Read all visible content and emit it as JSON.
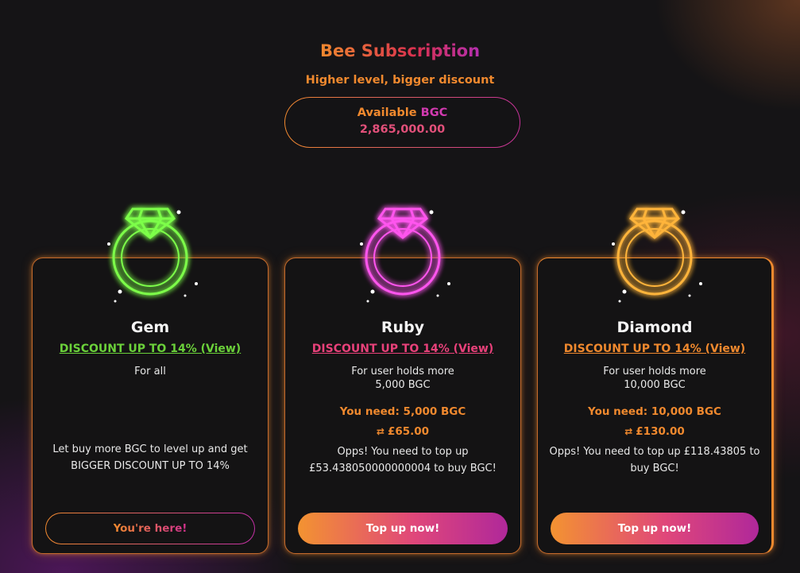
{
  "header": {
    "title": "Bee Subscription",
    "subtitle": "Higher level, bigger discount"
  },
  "balance": {
    "label": "Available",
    "currency": "BGC",
    "value": "2,865,000.00"
  },
  "colors": {
    "accent_orange": "#f0892e",
    "accent_pink": "#e8417a",
    "accent_purple": "#b42fb0",
    "gem_green": "#6bd13a",
    "background": "#151416"
  },
  "tiers": [
    {
      "icon": "green-diamond-ring-icon",
      "name": "Gem",
      "discount": "DISCOUNT UP TO 14% (View)",
      "condition_line1": "For all",
      "condition_line2": "",
      "need": "",
      "price": "",
      "message": "Let buy more BGC to level up and get BIGGER DISCOUNT UP TO 14%",
      "button": "You're here!"
    },
    {
      "icon": "pink-diamond-ring-icon",
      "name": "Ruby",
      "discount": "DISCOUNT UP TO 14% (View)",
      "condition_line1": "For user holds more",
      "condition_line2": "5,000 BGC",
      "need": "You need: 5,000 BGC",
      "price": "£65.00",
      "message": "Opps! You need to top up £53.438050000000004 to buy BGC!",
      "button": "Top up now!"
    },
    {
      "icon": "gold-diamond-ring-icon",
      "name": "Diamond",
      "discount": "DISCOUNT UP TO 14% (View)",
      "condition_line1": "For user holds more",
      "condition_line2": "10,000 BGC",
      "need": "You need: 10,000 BGC",
      "price": "£130.00",
      "message": "Opps! You need to top up £118.43805 to buy BGC!",
      "button": "Top up now!"
    }
  ]
}
